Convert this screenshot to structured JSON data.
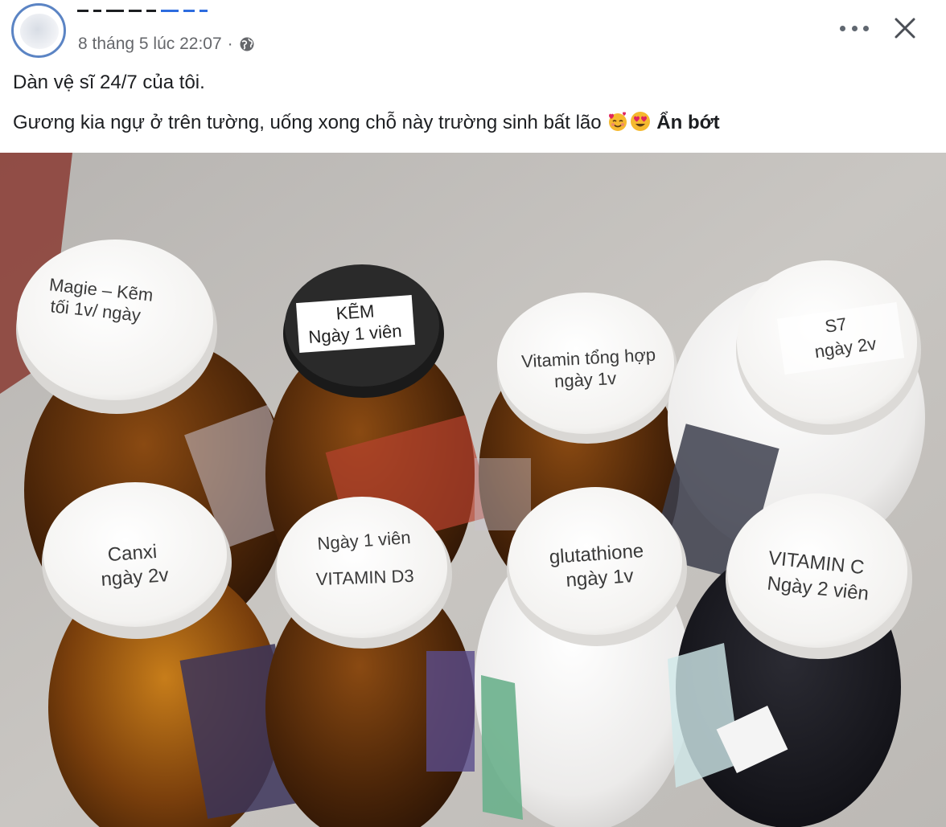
{
  "post": {
    "timestamp": "8 tháng 5 lúc 22:07",
    "separator": "·",
    "privacy_icon": "globe-icon",
    "more_icon": "more-options-icon",
    "close_icon": "close-icon",
    "caption_line1": "Dàn vệ sĩ 24/7 của tôi.",
    "caption_line2": "Gương kia ngự ở trên tường, uống xong chỗ này trường sinh bất lão",
    "emojis": [
      "smiling-face-with-hearts-icon",
      "heart-eyes-icon"
    ],
    "see_less_label": "Ẩn bớt"
  },
  "photo": {
    "bottle_labels": [
      {
        "line1": "Magie – Kẽm",
        "line2": "tối 1v/ ngày"
      },
      {
        "line1": "KẼM",
        "line2": "Ngày 1 viên"
      },
      {
        "line1": "Vitamin tổng hợp",
        "line2": "ngày 1v"
      },
      {
        "line1": "S7",
        "line2": "ngày 2v"
      },
      {
        "line1": "Canxi",
        "line2": "ngày 2v"
      },
      {
        "line1": "Ngày 1 viên",
        "line2": "VITAMIN D3"
      },
      {
        "line1": "glutathione",
        "line2": "ngày 1v"
      },
      {
        "line1": "VITAMIN C",
        "line2": "Ngày 2 viên"
      }
    ]
  }
}
